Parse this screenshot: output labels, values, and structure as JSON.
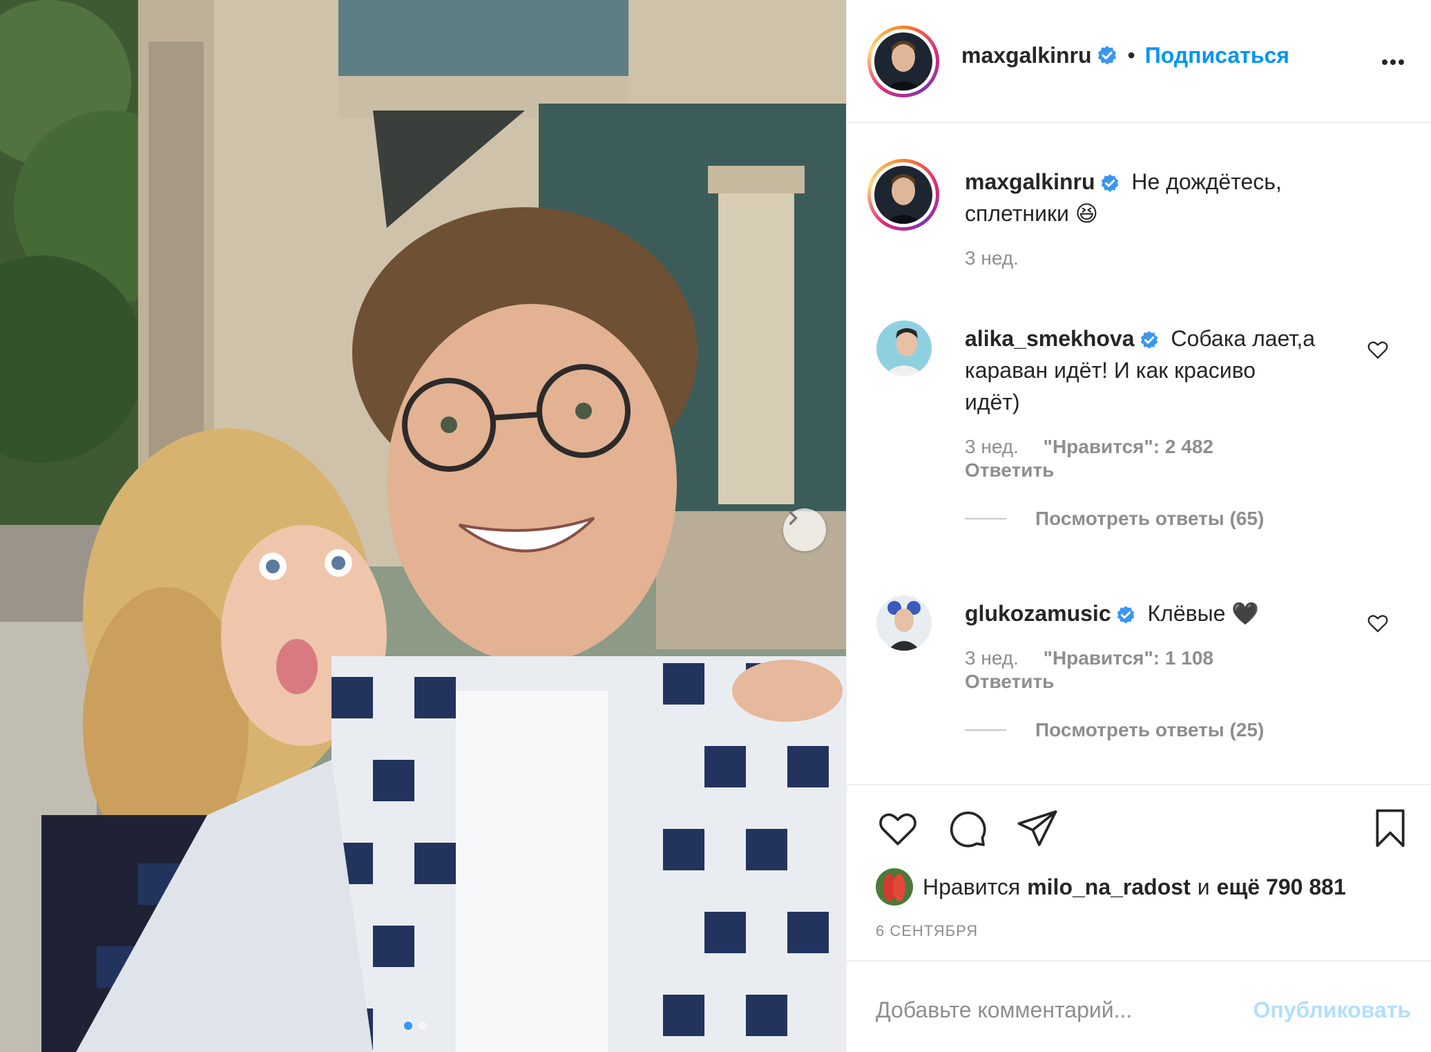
{
  "post": {
    "author": "maxgalkinru",
    "separator": "•",
    "follow_label": "Подписаться",
    "more_icon": "ellipsis-icon"
  },
  "caption": {
    "username": "maxgalkinru",
    "text_line1": "Не дождётесь,",
    "text_line2": "сплетники 😆",
    "time": "3 нед."
  },
  "comments": [
    {
      "username": "alika_smekhova",
      "text_line1": "Собака лает,а",
      "text_line2": "караван идёт! И как красиво",
      "text_line3": "идёт)",
      "time": "3 нед.",
      "likes": "\"Нравится\": 2 482",
      "reply": "Ответить",
      "view_replies": "Посмотреть ответы (65)"
    },
    {
      "username": "glukozamusic",
      "text": "Клёвые 🖤",
      "time": "3 нед.",
      "likes": "\"Нравится\": 1 108",
      "reply": "Ответить",
      "view_replies": "Посмотреть ответы (25)"
    }
  ],
  "likes": {
    "prefix": "Нравится",
    "user": "milo_na_radost",
    "middle": "и",
    "rest": "ещё 790 881"
  },
  "date": "6 СЕНТЯБРЯ",
  "add_comment": {
    "placeholder": "Добавьте комментарий...",
    "post_label": "Опубликовать"
  },
  "carousel": {
    "total": 2,
    "active": 1
  },
  "colors": {
    "accent": "#0095f6",
    "verified": "#3897f0",
    "muted": "#8e8e8e"
  }
}
